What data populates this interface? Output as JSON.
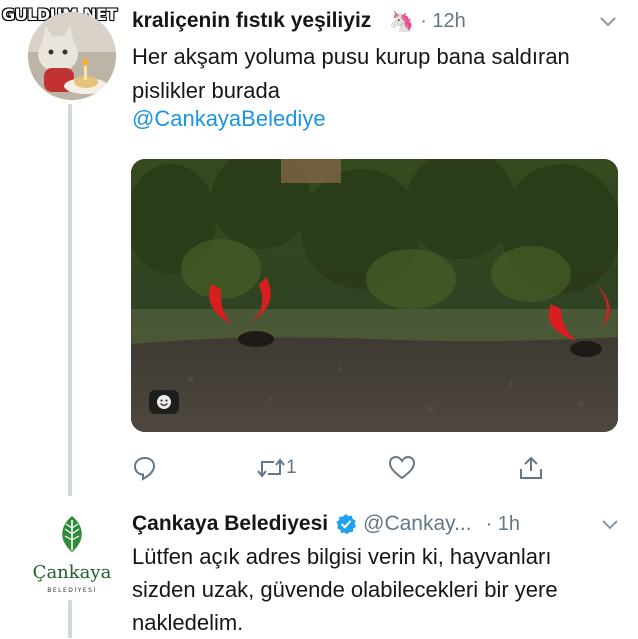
{
  "watermark": "GULDUM.NET",
  "tweet1": {
    "display_name": "kraliçenin fıstık yeşiliyiz",
    "name_emoji": "🦄",
    "time": "· 12h",
    "text": "Her akşam yoluma pusu kurup bana saldıran pislikler burada",
    "mention": "@CankayaBelediye",
    "actions": {
      "retweet_count": "1"
    }
  },
  "tweet2": {
    "display_name": "Çankaya Belediyesi",
    "handle": "@Cankay...",
    "time": "· 1h",
    "text": "Lütfen açık adres bilgisi verin ki, hayvanları sizden uzak, güvende olabilecekleri bir yere nakledelim.",
    "avatar": {
      "logo_word": "Çankaya",
      "logo_sub": "BELEDİYESİ"
    }
  },
  "colors": {
    "link": "#1b95e0",
    "muted": "#657786",
    "verified": "#1da1f2",
    "thread": "#cfd9de",
    "logo_green": "#2e8b3a"
  },
  "icons": [
    "reply-icon",
    "retweet-icon",
    "like-icon",
    "share-icon",
    "chevron-down-icon",
    "verified-badge-icon",
    "smiley-sticker-icon"
  ]
}
